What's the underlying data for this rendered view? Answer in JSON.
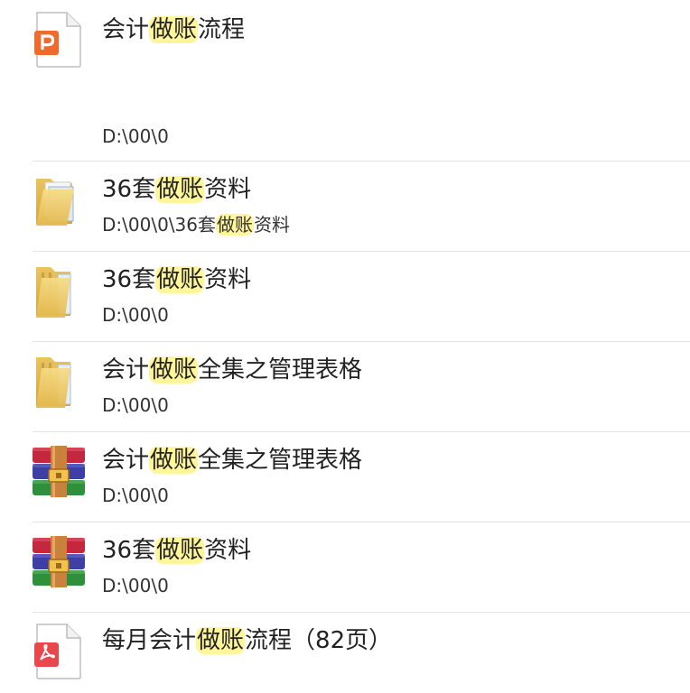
{
  "results": [
    {
      "icon": "powerpoint-file-icon",
      "title_pre": "会计",
      "title_hl": "做账",
      "title_post": "流程",
      "path_pre": "D:\\00\\0",
      "path_hl": "",
      "path_post": ""
    },
    {
      "icon": "folder-with-documents-icon",
      "title_pre": "36套",
      "title_hl": "做账",
      "title_post": "资料",
      "path_pre": "D:\\00\\0\\36套",
      "path_hl": "做账",
      "path_post": "资料"
    },
    {
      "icon": "folder-icon",
      "title_pre": "36套",
      "title_hl": "做账",
      "title_post": "资料",
      "path_pre": "D:\\00\\0",
      "path_hl": "",
      "path_post": ""
    },
    {
      "icon": "folder-icon",
      "title_pre": "会计",
      "title_hl": "做账",
      "title_post": "全集之管理表格",
      "path_pre": "D:\\00\\0",
      "path_hl": "",
      "path_post": ""
    },
    {
      "icon": "winrar-archive-icon",
      "title_pre": "会计",
      "title_hl": "做账",
      "title_post": "全集之管理表格",
      "path_pre": "D:\\00\\0",
      "path_hl": "",
      "path_post": ""
    },
    {
      "icon": "winrar-archive-icon",
      "title_pre": "36套",
      "title_hl": "做账",
      "title_post": "资料",
      "path_pre": "D:\\00\\0",
      "path_hl": "",
      "path_post": ""
    },
    {
      "icon": "pdf-file-icon",
      "title_pre": "每月会计",
      "title_hl": "做账",
      "title_post": "流程（82页）",
      "path_pre": "",
      "path_hl": "",
      "path_post": ""
    }
  ],
  "colors": {
    "highlight": "#fff59a",
    "separator": "#e3e3e3",
    "ppt_orange": "#ef6a2c",
    "pdf_red": "#e8474b",
    "folder_yellow": "#f2cf6a"
  }
}
